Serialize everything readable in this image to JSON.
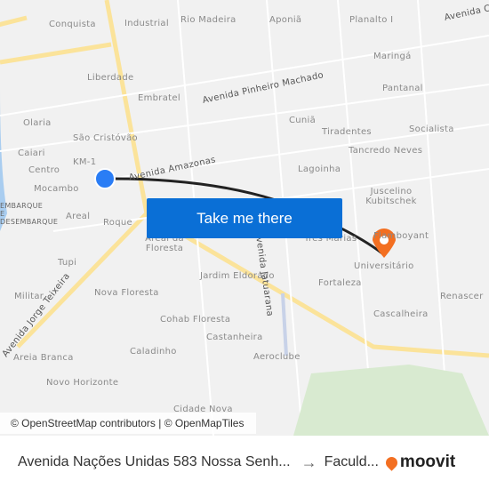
{
  "map": {
    "labels": [
      "Conquista",
      "Industrial",
      "Rio Madeira",
      "Aponiã",
      "Planalto I",
      "Maringá",
      "Liberdade",
      "Embratel",
      "Pantanal",
      "Olaria",
      "Cuniã",
      "Tiradentes",
      "Socialista",
      "São Cristóvão",
      "Caiari",
      "KM-1",
      "Tancredo Neves",
      "Centro",
      "Lagoinha",
      "Mocambo",
      "Juscelino Kubitschek",
      "Areal",
      "Roque",
      "Areal da Floresta",
      "Três Marias",
      "Flamboyant",
      "Universitário",
      "Tupi",
      "Jardim Eldorado",
      "Fortaleza",
      "Militar",
      "Nova Floresta",
      "Renascer",
      "Cohab Floresta",
      "Cascalheira",
      "Castanheira",
      "Caladinho",
      "Aeroclube",
      "Areia Branca",
      "Novo Horizonte",
      "Cidade Nova",
      "EMBARQUE E DESEMBARQUE"
    ],
    "streets": [
      "Avenida Pinheiro Machado",
      "Avenida Amazonas",
      "Avenida Calama",
      "Avenida Jatuarana",
      "Avenida Jorge Teixeira"
    ],
    "route_color": "#222222",
    "origin_color": "#2a7df5",
    "destination_color": "#f36f21"
  },
  "cta": {
    "label": "Take me there",
    "color": "#0a6fd6"
  },
  "attribution": "© OpenStreetMap contributors | © OpenMapTiles",
  "footer": {
    "from": "Avenida Nações Unidas 583 Nossa Senh...",
    "arrow": "→",
    "to": "Faculd...",
    "brand": "moovit"
  }
}
